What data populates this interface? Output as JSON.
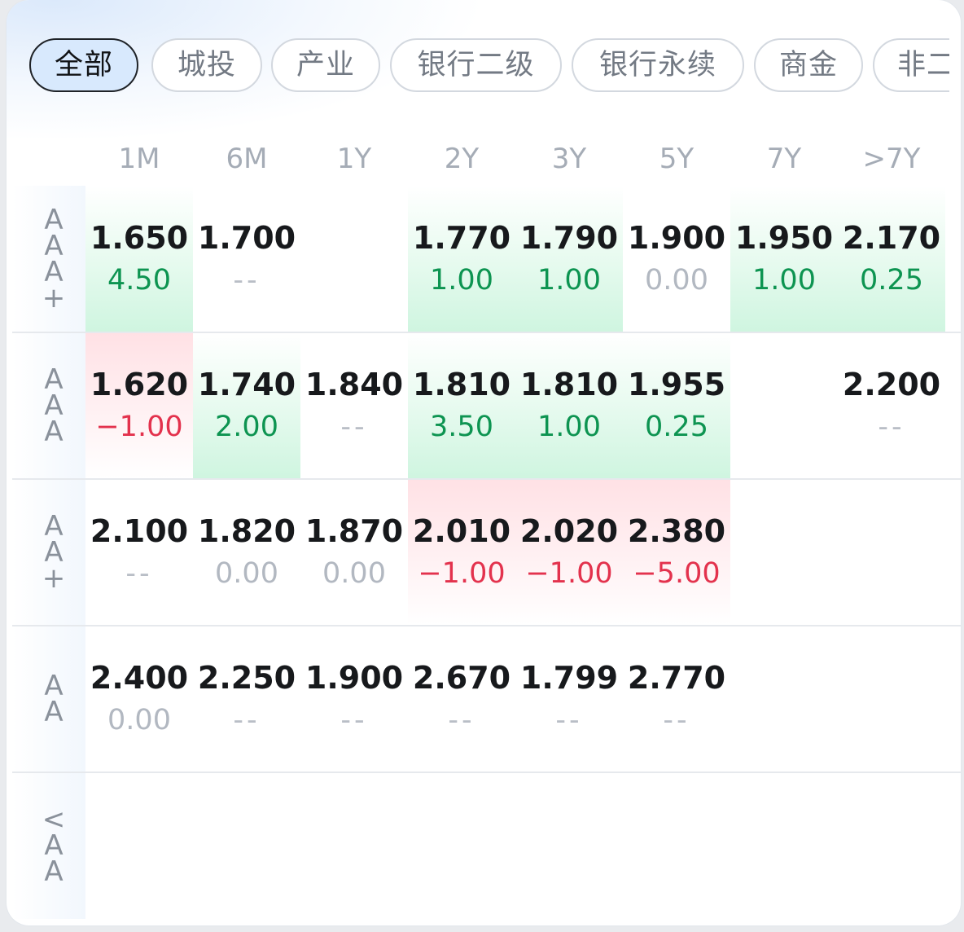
{
  "tabs": [
    {
      "label": "全部",
      "active": true
    },
    {
      "label": "城投",
      "active": false
    },
    {
      "label": "产业",
      "active": false
    },
    {
      "label": "银行二级",
      "active": false
    },
    {
      "label": "银行永续",
      "active": false
    },
    {
      "label": "商金",
      "active": false
    },
    {
      "label": "非二",
      "active": false
    }
  ],
  "columns": [
    "1M",
    "6M",
    "1Y",
    "2Y",
    "3Y",
    "5Y",
    "7Y",
    ">7Y"
  ],
  "rows": [
    {
      "label": [
        "A",
        "A",
        "A",
        "+"
      ],
      "cells": [
        {
          "value": "1.650",
          "change": "4.50",
          "trend": "up"
        },
        {
          "value": "1.700",
          "change": "--",
          "trend": "none"
        },
        {
          "value": "",
          "change": "",
          "trend": "empty"
        },
        {
          "value": "1.770",
          "change": "1.00",
          "trend": "up"
        },
        {
          "value": "1.790",
          "change": "1.00",
          "trend": "up"
        },
        {
          "value": "1.900",
          "change": "0.00",
          "trend": "zero"
        },
        {
          "value": "1.950",
          "change": "1.00",
          "trend": "up"
        },
        {
          "value": "2.170",
          "change": "0.25",
          "trend": "up"
        }
      ]
    },
    {
      "label": [
        "A",
        "A",
        "A"
      ],
      "cells": [
        {
          "value": "1.620",
          "change": "−1.00",
          "trend": "down"
        },
        {
          "value": "1.740",
          "change": "2.00",
          "trend": "up"
        },
        {
          "value": "1.840",
          "change": "--",
          "trend": "none"
        },
        {
          "value": "1.810",
          "change": "3.50",
          "trend": "up"
        },
        {
          "value": "1.810",
          "change": "1.00",
          "trend": "up"
        },
        {
          "value": "1.955",
          "change": "0.25",
          "trend": "up"
        },
        {
          "value": "",
          "change": "",
          "trend": "empty"
        },
        {
          "value": "2.200",
          "change": "--",
          "trend": "none"
        }
      ]
    },
    {
      "label": [
        "A",
        "A",
        "+"
      ],
      "cells": [
        {
          "value": "2.100",
          "change": "--",
          "trend": "none"
        },
        {
          "value": "1.820",
          "change": "0.00",
          "trend": "zero"
        },
        {
          "value": "1.870",
          "change": "0.00",
          "trend": "zero"
        },
        {
          "value": "2.010",
          "change": "−1.00",
          "trend": "down"
        },
        {
          "value": "2.020",
          "change": "−1.00",
          "trend": "down"
        },
        {
          "value": "2.380",
          "change": "−5.00",
          "trend": "down"
        },
        {
          "value": "",
          "change": "",
          "trend": "empty"
        },
        {
          "value": "",
          "change": "",
          "trend": "empty"
        }
      ]
    },
    {
      "label": [
        "A",
        "A"
      ],
      "cells": [
        {
          "value": "2.400",
          "change": "0.00",
          "trend": "zero"
        },
        {
          "value": "2.250",
          "change": "--",
          "trend": "none"
        },
        {
          "value": "1.900",
          "change": "--",
          "trend": "none"
        },
        {
          "value": "2.670",
          "change": "--",
          "trend": "none"
        },
        {
          "value": "1.799",
          "change": "--",
          "trend": "none"
        },
        {
          "value": "2.770",
          "change": "--",
          "trend": "none"
        },
        {
          "value": "",
          "change": "",
          "trend": "empty"
        },
        {
          "value": "",
          "change": "",
          "trend": "empty"
        }
      ]
    },
    {
      "label": [
        "<",
        "A",
        "A"
      ],
      "cells": [
        {
          "value": "",
          "change": "",
          "trend": "empty"
        },
        {
          "value": "",
          "change": "",
          "trend": "empty"
        },
        {
          "value": "",
          "change": "",
          "trend": "empty"
        },
        {
          "value": "",
          "change": "",
          "trend": "empty"
        },
        {
          "value": "",
          "change": "",
          "trend": "empty"
        },
        {
          "value": "",
          "change": "",
          "trend": "empty"
        },
        {
          "value": "",
          "change": "",
          "trend": "empty"
        },
        {
          "value": "",
          "change": "",
          "trend": "empty"
        }
      ]
    }
  ],
  "colors": {
    "positive": "#0d9451",
    "negative": "#e3324d",
    "neutral": "#b2b8c1",
    "active_tab_bg": "#d8e9fd"
  }
}
